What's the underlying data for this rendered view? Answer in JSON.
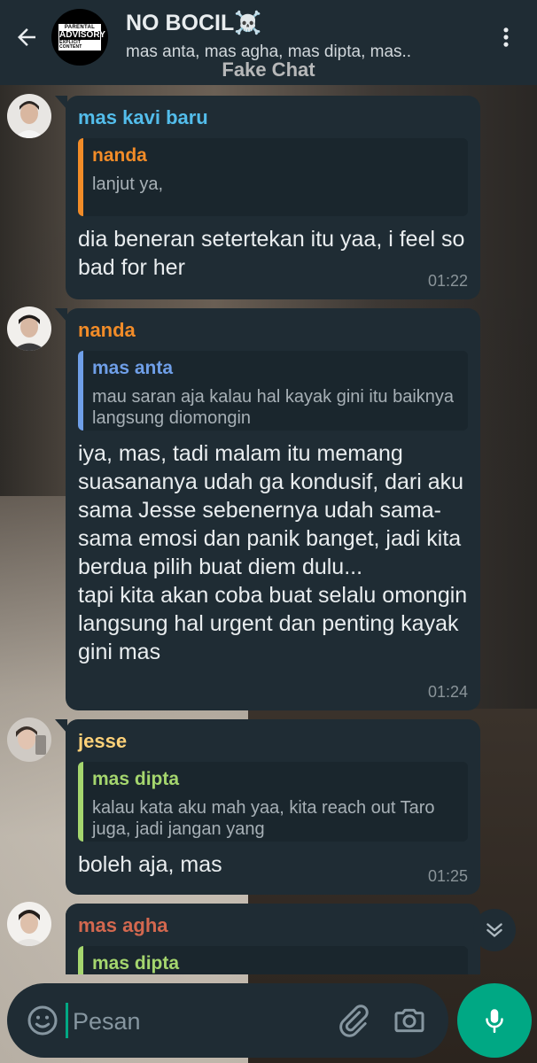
{
  "header": {
    "title": "NO BOCIL☠️",
    "subtitle": "mas anta, mas agha, mas dipta, mas..",
    "watermark": "Fake Chat",
    "group_avatar_text": {
      "top": "PARENTAL",
      "mid": "ADVISORY",
      "bottom": "EXPLICIT CONTENT"
    }
  },
  "colors": {
    "header_bg": "#1f2c34",
    "bubble_bg": "#1f2c34",
    "accent": "#00a884",
    "name_cyan": "#53bdeb",
    "name_orange": "#f28c28",
    "name_yellow": "#ffd279",
    "name_green": "#a5d66e",
    "name_blue": "#6f9fe8",
    "name_rust": "#d3684f"
  },
  "messages": [
    {
      "sender": "mas kavi baru",
      "sender_color": "#53bdeb",
      "quote": {
        "name": "nanda",
        "name_color": "#f28c28",
        "text": "lanjut ya,"
      },
      "text": "dia beneran setertekan itu yaa, i feel so bad for her",
      "time": "01:22"
    },
    {
      "sender": "nanda",
      "sender_color": "#f28c28",
      "quote": {
        "name": "mas anta",
        "name_color": "#6f9fe8",
        "text": "mau saran aja kalau hal kayak gini itu baiknya langsung diomongin"
      },
      "text": "iya, mas, tadi malam itu memang suasananya udah ga kondusif, dari aku sama Jesse sebenernya udah sama-sama emosi dan panik banget, jadi kita berdua pilih buat diem dulu...\ntapi kita akan coba buat selalu omongin langsung hal urgent dan penting kayak gini mas",
      "time": "01:24"
    },
    {
      "sender": "jesse",
      "sender_color": "#ffd279",
      "quote": {
        "name": "mas dipta",
        "name_color": "#a5d66e",
        "text": "kalau kata aku mah yaa, kita reach out Taro juga, jadi jangan yang"
      },
      "text": "boleh aja, mas",
      "time": "01:25"
    },
    {
      "sender": "mas agha",
      "sender_color": "#d3684f",
      "quote": {
        "name": "mas dipta",
        "name_color": "#a5d66e",
        "text": ""
      },
      "text": "",
      "time": ""
    }
  ],
  "input": {
    "placeholder": "Pesan"
  },
  "icons": {
    "back": "arrow-left-icon",
    "menu": "more-vert-icon",
    "emoji": "emoji-icon",
    "attach": "paperclip-icon",
    "camera": "camera-icon",
    "mic": "mic-icon",
    "scroll_down": "double-chevron-down-icon"
  }
}
